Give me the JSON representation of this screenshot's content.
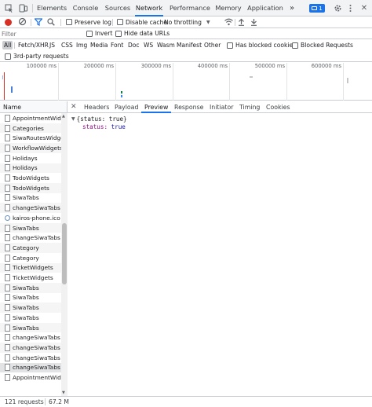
{
  "devtools": {
    "tabs": [
      {
        "label": "Elements"
      },
      {
        "label": "Console"
      },
      {
        "label": "Sources"
      },
      {
        "label": "Network"
      },
      {
        "label": "Performance"
      },
      {
        "label": "Memory"
      },
      {
        "label": "Application"
      }
    ],
    "more_tabs": "»",
    "issues_count": "1",
    "accent": "#1a73e8"
  },
  "toolbar": {
    "preserve_log": "Preserve log",
    "disable_cache": "Disable cache",
    "throttling": "No throttling"
  },
  "filter": {
    "placeholder": "Filter",
    "invert": "Invert",
    "hide_data_urls": "Hide data URLs",
    "types": [
      "All",
      "Fetch/XHR",
      "JS",
      "CSS",
      "Img",
      "Media",
      "Font",
      "Doc",
      "WS",
      "Wasm",
      "Manifest",
      "Other"
    ],
    "has_blocked_cookies": "Has blocked cookies",
    "blocked_requests": "Blocked Requests",
    "third_party": "3rd-party requests"
  },
  "overview": {
    "ticks": [
      "100000 ms",
      "200000 ms",
      "300000 ms",
      "400000 ms",
      "500000 ms",
      "600000 ms"
    ]
  },
  "requests": {
    "name_header": "Name",
    "items": [
      "AppointmentWid...",
      "Categories",
      "SiwaRoutesWidget",
      "WorkflowWidgets",
      "Holidays",
      "Holidays",
      "TodoWidgets",
      "TodoWidgets",
      "SiwaTabs",
      "changeSiwaTabs",
      "kairos-phone.ico",
      "SiwaTabs",
      "changeSiwaTabs",
      "Category",
      "Category",
      "TicketWidgets",
      "TicketWidgets",
      "SiwaTabs",
      "SiwaTabs",
      "SiwaTabs",
      "SiwaTabs",
      "SiwaTabs",
      "changeSiwaTabs",
      "changeSiwaTabs",
      "changeSiwaTabs",
      "changeSiwaTabs",
      "AppointmentWid..."
    ]
  },
  "detail": {
    "tabs": [
      "Headers",
      "Payload",
      "Preview",
      "Response",
      "Initiator",
      "Timing",
      "Cookies"
    ],
    "active_tab": "Preview",
    "preview": {
      "summary": "{status: true}",
      "key": "status",
      "value": "true"
    }
  },
  "status": {
    "requests": "121 requests",
    "transferred": "67.2 M"
  }
}
